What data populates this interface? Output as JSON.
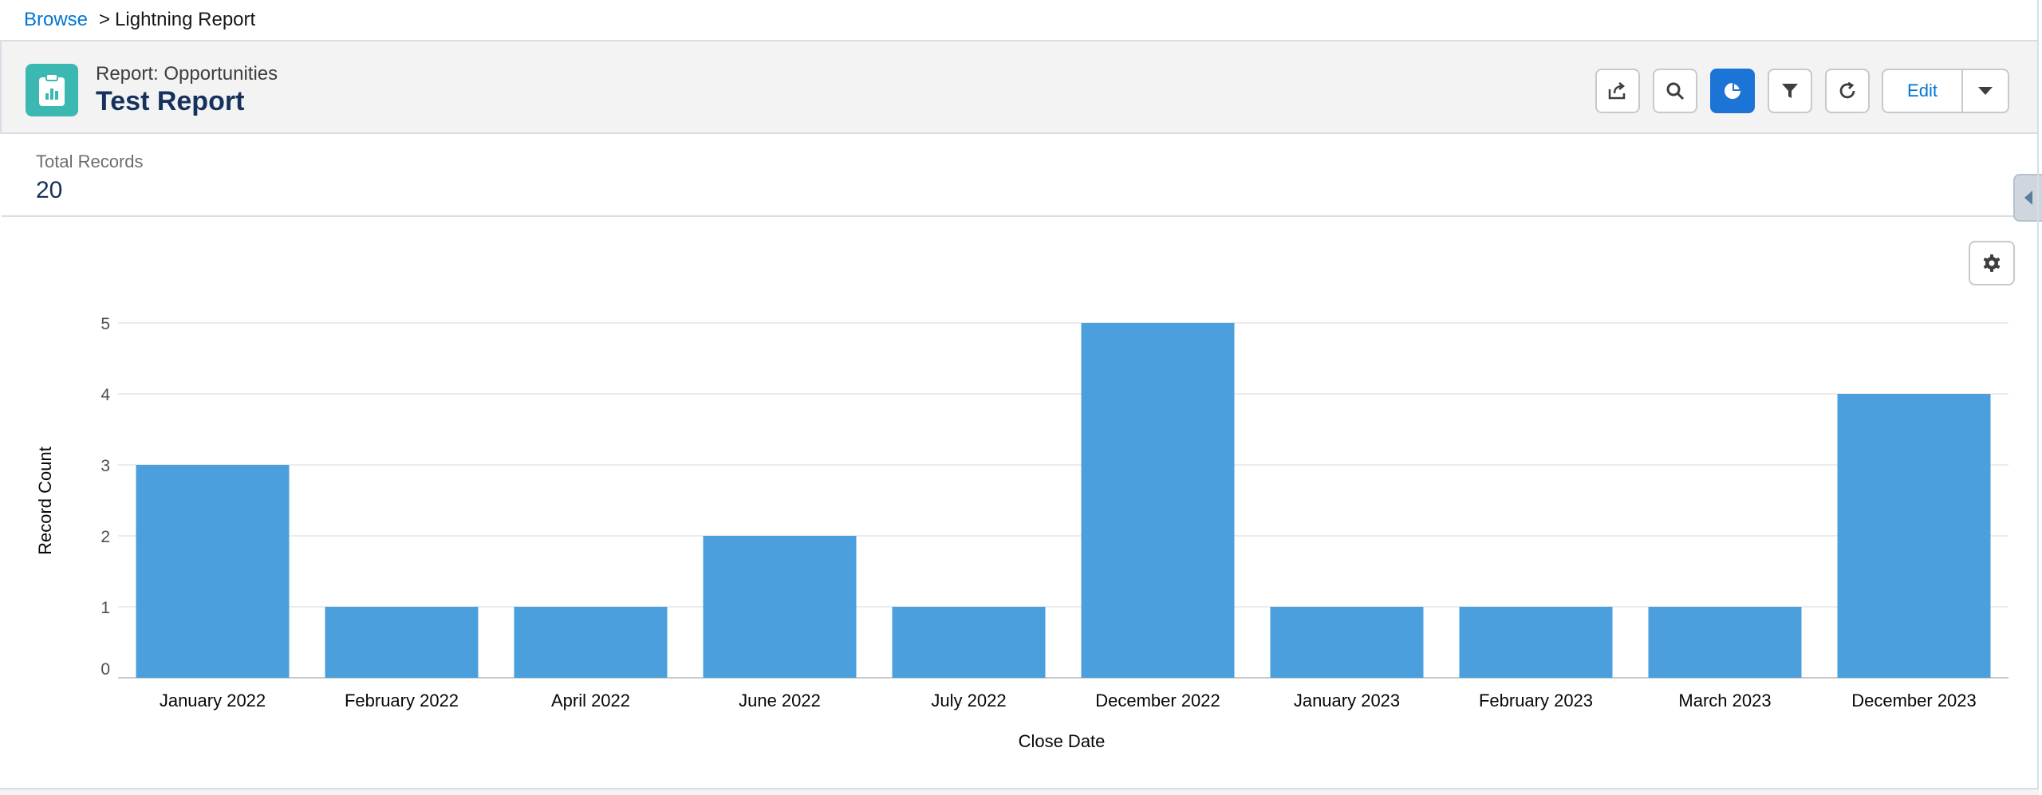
{
  "breadcrumb": {
    "link": "Browse",
    "separator": ">",
    "current": "Lightning Report"
  },
  "header": {
    "subtitle": "Report: Opportunities",
    "title": "Test Report",
    "icon": "report-icon",
    "toolbar": {
      "share": "share-icon",
      "search": "search-icon",
      "chart": "chart-icon",
      "filter": "filter-icon",
      "refresh": "refresh-icon",
      "edit_label": "Edit",
      "edit_menu": "chevron-down-icon"
    }
  },
  "summary": {
    "label": "Total Records",
    "value": "20"
  },
  "colors": {
    "accent": "#0176d3",
    "bar": "#4a9fdc",
    "active_button": "#1b74d6",
    "icon_bg": "#3bb8b2"
  },
  "chart_data": {
    "type": "bar",
    "categories": [
      "January 2022",
      "February 2022",
      "April 2022",
      "June 2022",
      "July 2022",
      "December 2022",
      "January 2023",
      "February 2023",
      "March 2023",
      "December 2023"
    ],
    "values": [
      3,
      1,
      1,
      2,
      1,
      5,
      1,
      1,
      1,
      4
    ],
    "xlabel": "Close Date",
    "ylabel": "Record Count",
    "ylim": [
      0,
      5
    ],
    "yticks": [
      0,
      1,
      2,
      3,
      4,
      5
    ],
    "grid": true
  }
}
